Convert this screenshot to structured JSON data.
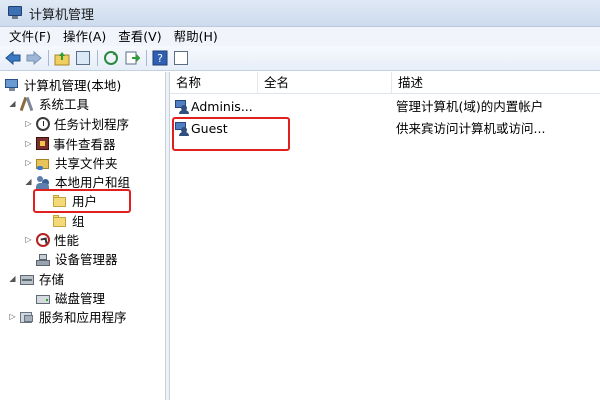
{
  "window": {
    "title": "计算机管理"
  },
  "menu": [
    {
      "label": "文件(F)"
    },
    {
      "label": "操作(A)"
    },
    {
      "label": "查看(V)"
    },
    {
      "label": "帮助(H)"
    }
  ],
  "tree": {
    "root": "计算机管理(本地)",
    "system_tools": "系统工具",
    "task_scheduler": "任务计划程序",
    "event_viewer": "事件查看器",
    "shared_folders": "共享文件夹",
    "local_users_groups": "本地用户和组",
    "users": "用户",
    "groups": "组",
    "performance": "性能",
    "device_manager": "设备管理器",
    "storage": "存储",
    "disk_management": "磁盘管理",
    "services_apps": "服务和应用程序"
  },
  "list": {
    "columns": {
      "name": "名称",
      "fullname": "全名",
      "description": "描述"
    },
    "rows": [
      {
        "name": "Adminis...",
        "fullname": "",
        "description": "管理计算机(域)的内置帐户"
      },
      {
        "name": "Guest",
        "fullname": "",
        "description": "供来宾访问计算机或访问..."
      }
    ]
  },
  "colors": {
    "highlight": "#e0201f",
    "titlebar": "#cddbed"
  }
}
